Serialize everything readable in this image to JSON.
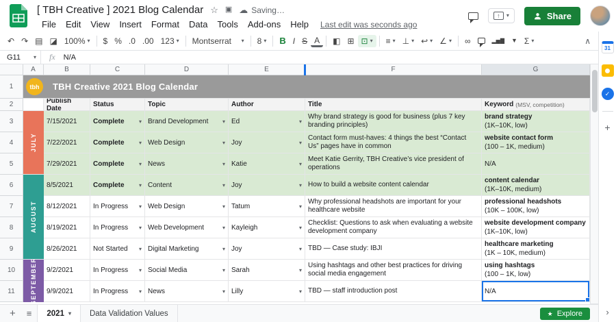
{
  "app": {
    "doc_title": "[ TBH Creative ] 2021 Blog Calendar",
    "saving": "Saving…",
    "menu": [
      "File",
      "Edit",
      "View",
      "Insert",
      "Format",
      "Data",
      "Tools",
      "Add-ons",
      "Help"
    ],
    "last_edit": "Last edit was seconds ago",
    "share_label": "Share"
  },
  "toolbar": {
    "zoom": "100%",
    "font": "Montserrat",
    "font_size": "8"
  },
  "formula": {
    "cell_ref": "G11",
    "fx": "fx",
    "value": "N/A"
  },
  "icons": {
    "undo": "↶",
    "redo": "↷",
    "print": "▤",
    "paint_format": "◪",
    "dropdown": "▾",
    "dollar": "$",
    "percent": "%",
    "decimal_decrease": ".0",
    "decimal_increase": ".00",
    "more_formats": "123",
    "bold": "B",
    "italic": "I",
    "strikethrough": "S",
    "text_color": "A",
    "fill_color": "◧",
    "borders": "⊞",
    "merge_cells": "⊡",
    "horizontal_align": "≡",
    "vertical_align": "⊥",
    "text_wrap": "↩",
    "text_rotation": "∠",
    "insert_link": "∞",
    "insert_chart": "▂▅▇",
    "create_filter": "▼",
    "functions": "Σ",
    "collapse_toolbar": "∧",
    "star": "☆",
    "cloud": "☁",
    "present": "↑",
    "add": "+",
    "all_sheets": "≡",
    "chevron_right": "›",
    "check": "✓",
    "explore_star": "★"
  },
  "sheet": {
    "column_letters": [
      "A",
      "B",
      "C",
      "D",
      "E",
      "F",
      "G"
    ],
    "row_numbers": [
      1,
      2,
      3,
      4,
      5,
      6,
      7,
      8,
      9,
      10,
      11
    ],
    "banner": {
      "logo_text": "tbh",
      "title": "TBH Creative 2021 Blog Calendar"
    },
    "headers": {
      "date": "Publish Date",
      "status": "Status",
      "topic": "Topic",
      "author": "Author",
      "title": "Title",
      "keyword": "Keyword",
      "keyword_note": "(MSV, competition)"
    },
    "months": [
      {
        "label": "JULY",
        "color": "#e8745a"
      },
      {
        "label": "AUGUST",
        "color": "#2e9e92"
      },
      {
        "label": "SEPTEMBER",
        "color": "#7d5ba6"
      }
    ],
    "rows": [
      {
        "date": "7/15/2021",
        "status": "Complete",
        "topic": "Brand Development",
        "author": "Ed",
        "title": "Why brand strategy is good for business (plus 7 key branding principles)",
        "keyword": "brand strategy",
        "keyword_detail": "(1K–10K, low)"
      },
      {
        "date": "7/22/2021",
        "status": "Complete",
        "topic": "Web Design",
        "author": "Joy",
        "title": "Contact form must-haves: 4 things the best “Contact Us” pages have in common",
        "keyword": "website contact form",
        "keyword_detail": "(100 – 1K, medium)"
      },
      {
        "date": "7/29/2021",
        "status": "Complete",
        "topic": "News",
        "author": "Katie",
        "title": "Meet Katie Gerrity, TBH Creative’s vice president of operations",
        "keyword": "N/A",
        "keyword_detail": ""
      },
      {
        "date": "8/5/2021",
        "status": "Complete",
        "topic": "Content",
        "author": "Joy",
        "title": "How to build a website content calendar",
        "keyword": "content calendar",
        "keyword_detail": "(1K–10K, medium)"
      },
      {
        "date": "8/12/2021",
        "status": "In Progress",
        "topic": "Web Design",
        "author": "Tatum",
        "title": "Why professional headshots are important for your healthcare website",
        "keyword": "professional headshots",
        "keyword_detail": "(10K – 100K, low)"
      },
      {
        "date": "8/19/2021",
        "status": "In Progress",
        "topic": "Web Development",
        "author": "Kayleigh",
        "title": "Checklist: Questions to ask when evaluating a website development company",
        "keyword": "website development company",
        "keyword_detail": "(1K–10K, low)"
      },
      {
        "date": "8/26/2021",
        "status": "Not Started",
        "topic": "Digital Marketing",
        "author": "Joy",
        "title": "TBD — Case study: IBJI",
        "keyword": "healthcare marketing",
        "keyword_detail": "(1K – 10K, medium)"
      },
      {
        "date": "9/2/2021",
        "status": "In Progress",
        "topic": "Social Media",
        "author": "Sarah",
        "title": "Using hashtags and other best practices for driving social media engagement",
        "keyword": "using hashtags",
        "keyword_detail": "(100 – 1K, low)"
      },
      {
        "date": "9/9/2021",
        "status": "In Progress",
        "topic": "News",
        "author": "Lilly",
        "title": "TBD — staff introduction post",
        "keyword": "N/A",
        "keyword_detail": ""
      }
    ]
  },
  "tabs": {
    "sheet_names": [
      "2021",
      "Data Validation Values"
    ],
    "active": "2021",
    "explore": "Explore"
  },
  "sidebar": {
    "calendar_label": "31"
  },
  "colors": {
    "share_green": "#188038",
    "selection_blue": "#1a73e8",
    "complete_row_green": "#d9ead3",
    "banner_gray": "#9a9a9a",
    "logo_yellow": "#f1b51c",
    "month_july": "#e8745a",
    "month_august": "#2e9e92",
    "month_september": "#7d5ba6"
  }
}
